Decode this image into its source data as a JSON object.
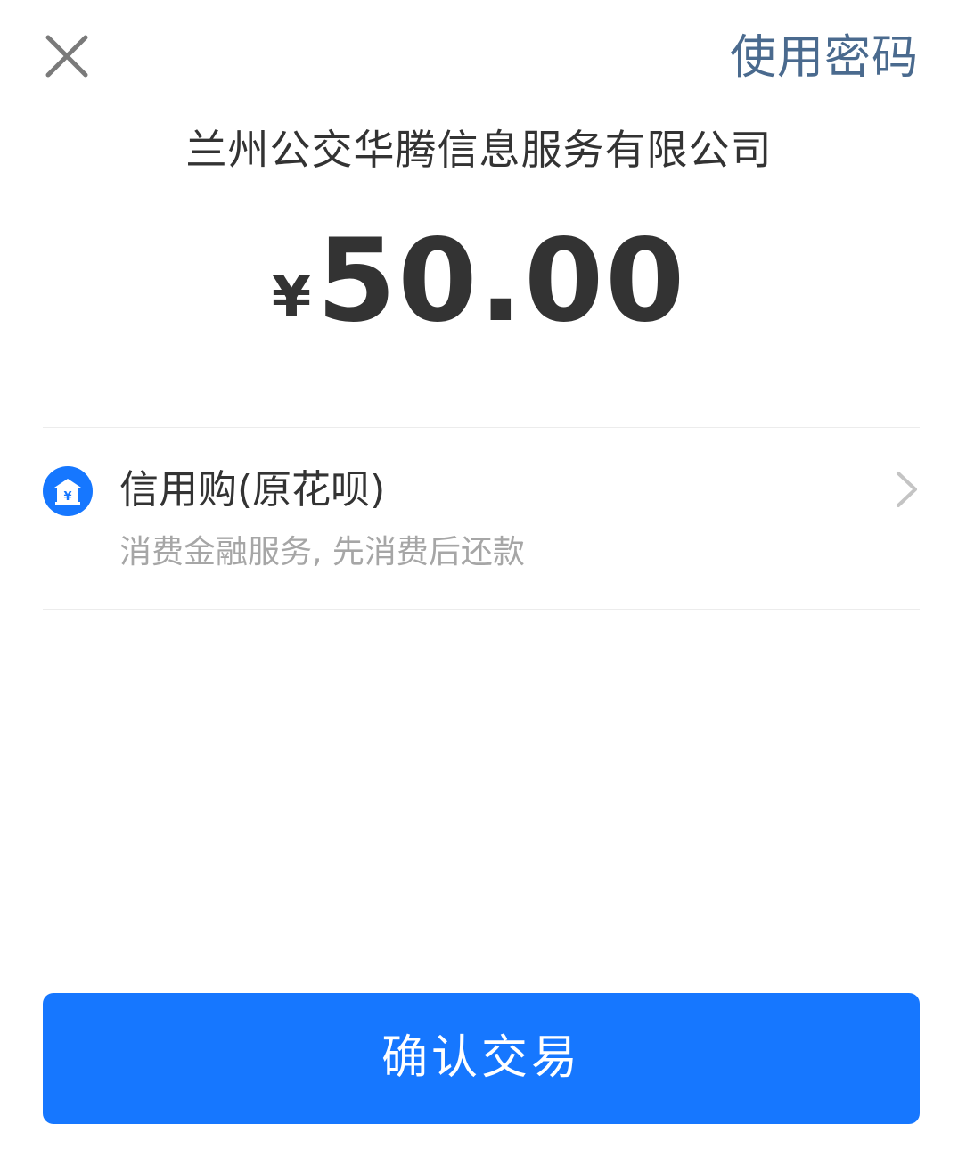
{
  "header": {
    "use_password_label": "使用密码"
  },
  "payment": {
    "merchant_name": "兰州公交华腾信息服务有限公司",
    "currency_symbol": "¥",
    "amount": "50.00"
  },
  "method": {
    "title": "信用购(原花呗)",
    "description": "消费金融服务, 先消费后还款",
    "icon": "bank-yuan-icon",
    "icon_color": "#1677ff"
  },
  "actions": {
    "confirm_label": "确认交易"
  },
  "colors": {
    "accent": "#1677ff",
    "link": "#4a6a8e"
  }
}
